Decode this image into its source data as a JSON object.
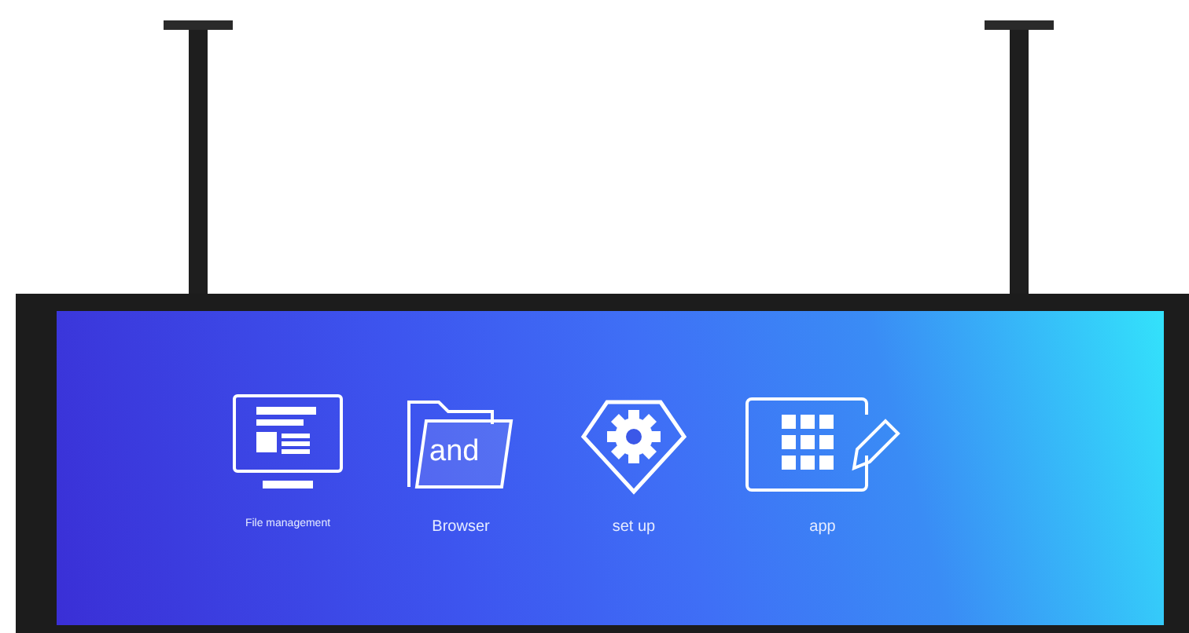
{
  "apps": [
    {
      "kind": "file",
      "label": "File management"
    },
    {
      "kind": "folder",
      "label": "Browser",
      "badge": "and"
    },
    {
      "kind": "settings",
      "label": "set up"
    },
    {
      "kind": "grid",
      "label": "app"
    }
  ]
}
